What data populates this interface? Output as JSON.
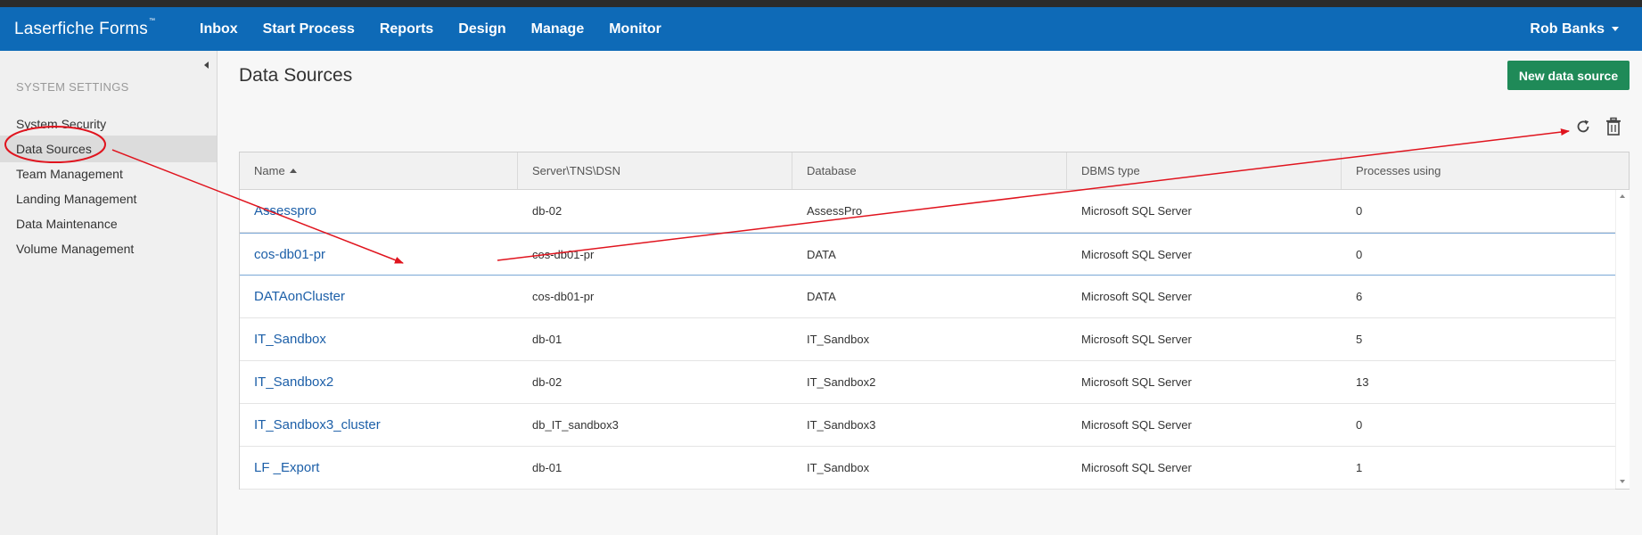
{
  "app": {
    "brand": "Laserfiche Forms",
    "trademark": "™"
  },
  "nav": {
    "items": [
      "Inbox",
      "Start Process",
      "Reports",
      "Design",
      "Manage",
      "Monitor"
    ],
    "user": "Rob Banks"
  },
  "sidebar": {
    "heading": "SYSTEM SETTINGS",
    "items": [
      "System Security",
      "Data Sources",
      "Team Management",
      "Landing Management",
      "Data Maintenance",
      "Volume Management"
    ],
    "active_index": 1
  },
  "main": {
    "title": "Data Sources",
    "new_button": "New data source",
    "icons": [
      "refresh-icon",
      "trash-icon"
    ]
  },
  "table": {
    "columns": [
      "Name",
      "Server\\TNS\\DSN",
      "Database",
      "DBMS type",
      "Processes using"
    ],
    "rows": [
      [
        "Assesspro",
        "db-02",
        "AssessPro",
        "Microsoft SQL Server",
        "0"
      ],
      [
        "cos-db01-pr",
        "cos-db01-pr",
        "DATA",
        "Microsoft SQL Server",
        "0"
      ],
      [
        "DATAonCluster",
        "cos-db01-pr",
        "DATA",
        "Microsoft SQL Server",
        "6"
      ],
      [
        "IT_Sandbox",
        "db-01",
        "IT_Sandbox",
        "Microsoft SQL Server",
        "5"
      ],
      [
        "IT_Sandbox2",
        "db-02",
        "IT_Sandbox2",
        "Microsoft SQL Server",
        "13"
      ],
      [
        "IT_Sandbox3_cluster",
        "db_IT_sandbox3",
        "IT_Sandbox3",
        "Microsoft SQL Server",
        "0"
      ],
      [
        "LF _Export",
        "db-01",
        "IT_Sandbox",
        "Microsoft SQL Server",
        "1"
      ]
    ],
    "selected_row": 1
  },
  "colors": {
    "navbar": "#0e6ab7",
    "accent_button": "#1f8a58",
    "link": "#1c5fa8",
    "annotation": "#e0141e"
  }
}
